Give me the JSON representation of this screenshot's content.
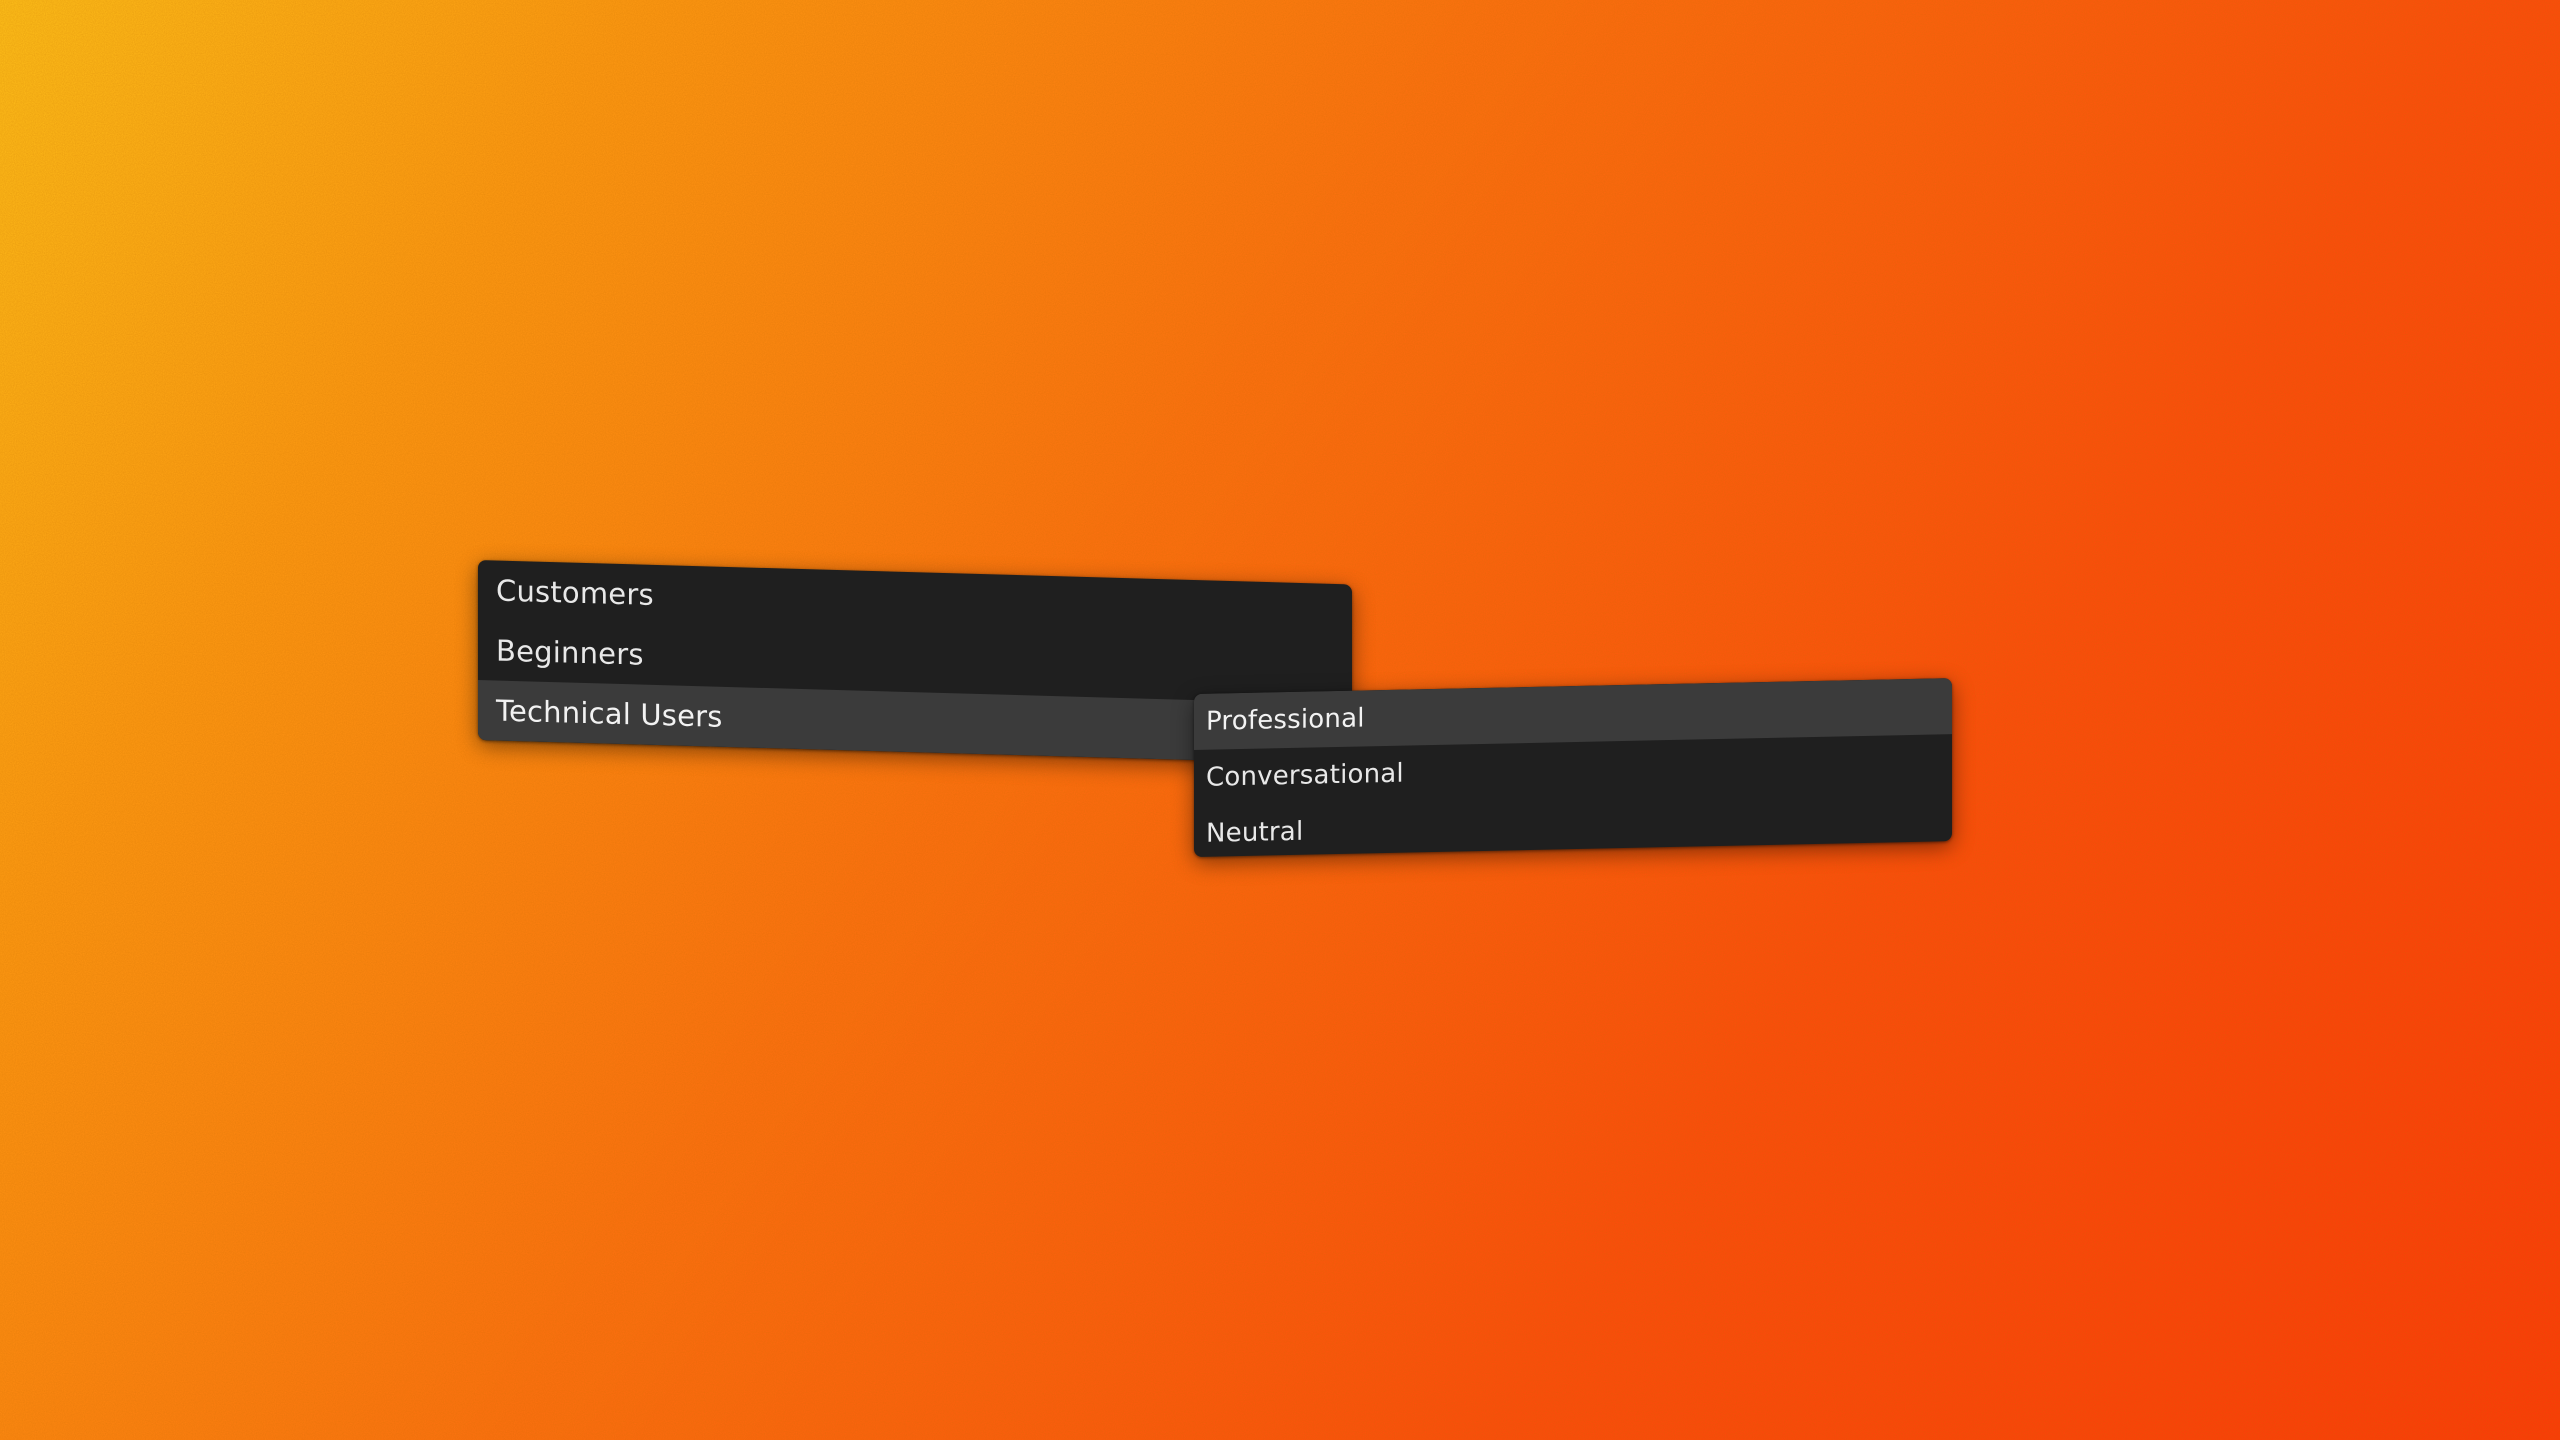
{
  "background": {
    "colors": [
      "#ffc21a",
      "#ff9a12",
      "#ff7010",
      "#ff4a0c",
      "#ff3608"
    ]
  },
  "menu": {
    "items": [
      {
        "label": "Customers",
        "active": false
      },
      {
        "label": "Beginners",
        "active": false
      },
      {
        "label": "Technical Users",
        "active": true
      }
    ]
  },
  "submenu": {
    "items": [
      {
        "label": "Professional",
        "active": true
      },
      {
        "label": "Conversational",
        "active": false
      },
      {
        "label": "Neutral",
        "active": false
      }
    ]
  },
  "colors": {
    "menu_bg": "#1f1f1f",
    "highlight_bg": "#3b3b3b",
    "text": "#e8e8e8"
  }
}
